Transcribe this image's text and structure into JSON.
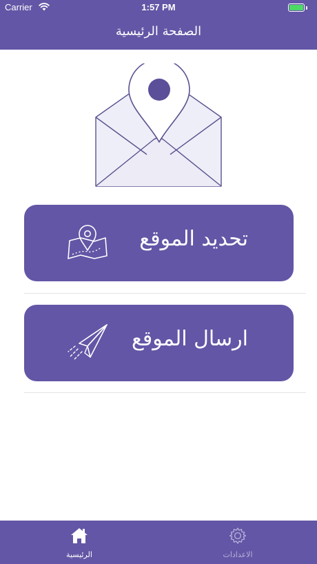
{
  "status_bar": {
    "carrier": "Carrier",
    "time": "1:57 PM",
    "battery_level": 1.0
  },
  "nav": {
    "title": "الصفحة الرئيسية"
  },
  "hero": {
    "icon": "envelope-location-pin-icon"
  },
  "actions": [
    {
      "label": "تحديد الموقع",
      "icon": "map-pin-icon"
    },
    {
      "label": "ارسال الموقع",
      "icon": "paper-plane-icon"
    }
  ],
  "tabs": [
    {
      "label": "الرئيسية",
      "icon": "home-icon",
      "selected": true
    },
    {
      "label": "الاعدادات",
      "icon": "gear-icon",
      "selected": false
    }
  ],
  "colors": {
    "primary": "#6356a6",
    "battery": "#4cd964",
    "tab_inactive": "#b9b2dc"
  }
}
